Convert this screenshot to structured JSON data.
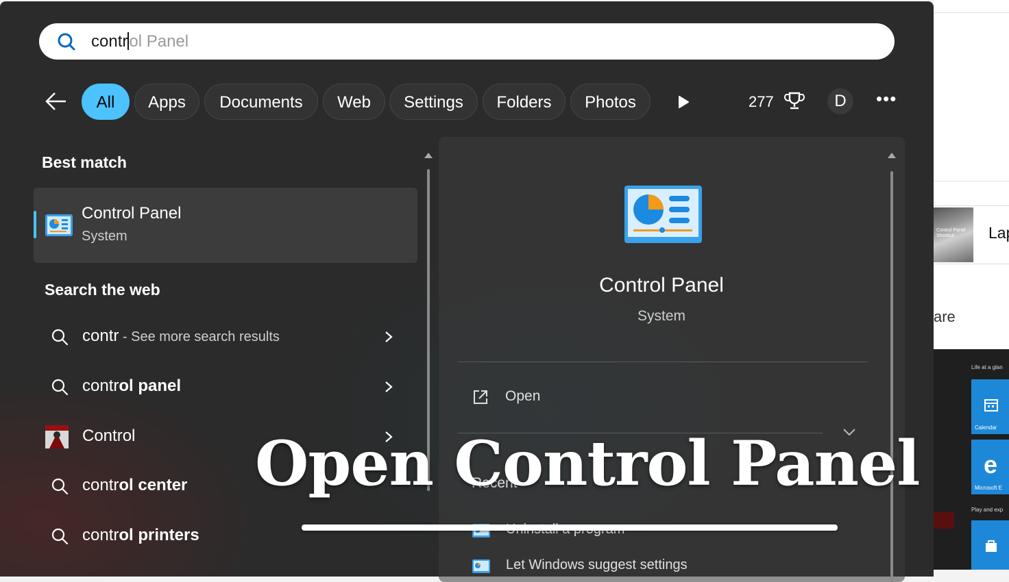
{
  "search": {
    "typed": "contr",
    "suggestion": "ol Panel"
  },
  "filters": {
    "chips": [
      "All",
      "Apps",
      "Documents",
      "Web",
      "Settings",
      "Folders",
      "Photos"
    ],
    "active": "All",
    "points": "277",
    "avatar_initial": "D"
  },
  "best_match": {
    "header": "Best match",
    "title": "Control Panel",
    "subtitle": "System"
  },
  "web": {
    "header": "Search the web",
    "items": [
      {
        "prefix": "contr",
        "suffix": "",
        "extra": " - See more search results"
      },
      {
        "prefix": "contr",
        "suffix": "ol panel",
        "extra": ""
      },
      {
        "prefix": "Control",
        "suffix": "",
        "extra": ""
      },
      {
        "prefix": "contr",
        "suffix": "ol center",
        "extra": ""
      },
      {
        "prefix": "contr",
        "suffix": "ol printers",
        "extra": ""
      }
    ]
  },
  "preview": {
    "title": "Control Panel",
    "subtitle": "System",
    "open_label": "Open",
    "recent_header": "Recent",
    "recent_items": [
      "Uninstall a program",
      "Let Windows suggest settings"
    ]
  },
  "overlay": {
    "title": "Open Control Panel"
  },
  "background": {
    "card_title": "Lap",
    "share_text": "are",
    "thumb_text": "Control Panel Shortcut",
    "start_text_1": "Life at a glan",
    "start_tile_1": "Calendar",
    "start_tile_2": "Microsoft E",
    "start_text_2": "Play and exp"
  },
  "colors": {
    "accent": "#4cc2ff",
    "panel_bg": "#2b2b2b",
    "tile_blue": "#1e88d8"
  }
}
